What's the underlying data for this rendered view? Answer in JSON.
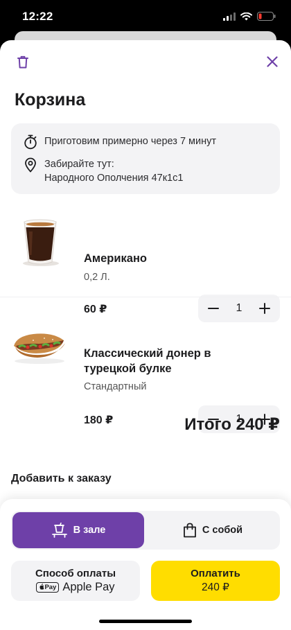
{
  "status_bar": {
    "time": "12:22"
  },
  "header": {
    "title": "Корзина"
  },
  "info": {
    "prep_time": "Приготовим примерно через 7 минут",
    "pickup_label": "Забирайте тут:",
    "pickup_address": "Народного Ополчения 47к1с1"
  },
  "items": [
    {
      "name": "Американо",
      "size": "0,2 Л.",
      "price": "60 ₽",
      "quantity": "1"
    },
    {
      "name": "Классический донер в турецкой булке",
      "size": "Стандартный",
      "price": "180 ₽",
      "quantity": "1"
    }
  ],
  "total": "Итого 240 ₽",
  "add_to_order": "Добавить к заказу",
  "dining": {
    "in_hall": "В зале",
    "takeaway": "С собой",
    "selected": "in_hall"
  },
  "payment": {
    "method_label": "Способ оплаты",
    "badge": "Pay",
    "method_value": "Apple Pay",
    "pay_label": "Оплатить",
    "pay_amount": "240 ₽"
  },
  "colors": {
    "accent": "#6e40a8",
    "pay_button": "#ffdd00",
    "card_bg": "#f3f3f5"
  },
  "icons": [
    "trash-icon",
    "close-icon",
    "stopwatch-icon",
    "location-pin-icon",
    "minus-icon",
    "plus-icon",
    "dine-in-icon",
    "shopping-bag-icon",
    "apple-icon"
  ]
}
